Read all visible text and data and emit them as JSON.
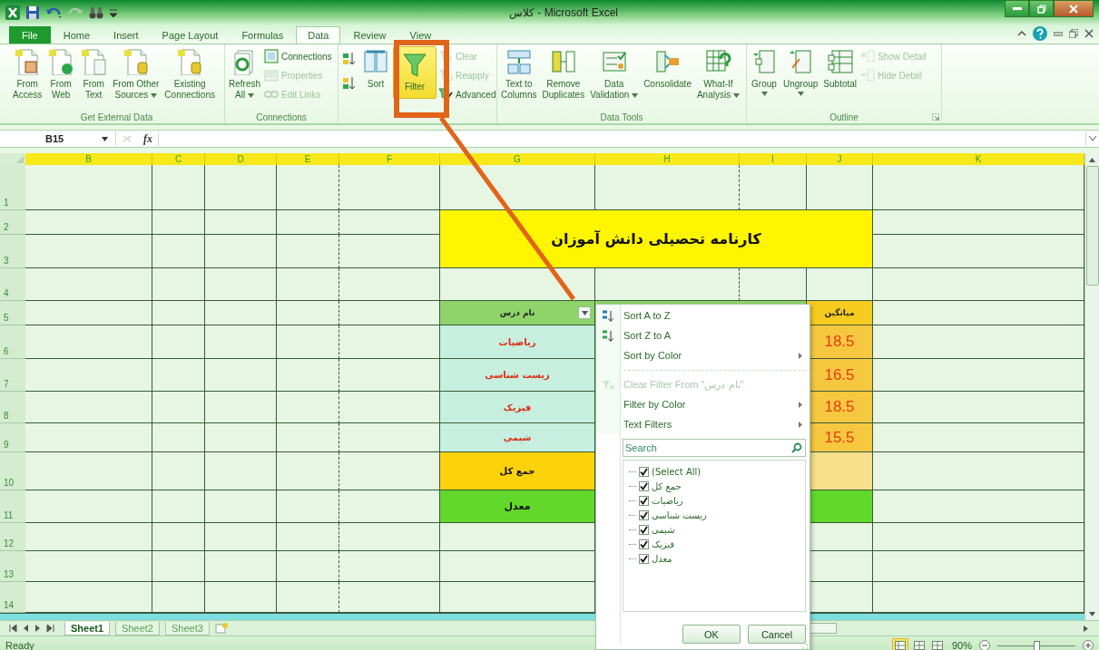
{
  "window": {
    "title": "کلاس - Microsoft Excel"
  },
  "ribbon_tabs": [
    {
      "label": "File",
      "kind": "file",
      "selected": false
    },
    {
      "label": "Home",
      "kind": "tab",
      "selected": false
    },
    {
      "label": "Insert",
      "kind": "tab",
      "selected": false
    },
    {
      "label": "Page Layout",
      "kind": "tab",
      "selected": false
    },
    {
      "label": "Formulas",
      "kind": "tab",
      "selected": false
    },
    {
      "label": "Data",
      "kind": "tab",
      "selected": true
    },
    {
      "label": "Review",
      "kind": "tab",
      "selected": false
    },
    {
      "label": "View",
      "kind": "tab",
      "selected": false
    }
  ],
  "ribbon_groups": [
    {
      "label": "Get External Data",
      "buttons": [
        {
          "label": "From\nAccess",
          "kind": "large",
          "dropdown": false,
          "disabled": false
        },
        {
          "label": "From\nWeb",
          "kind": "large",
          "dropdown": false,
          "disabled": false
        },
        {
          "label": "From\nText",
          "kind": "large",
          "dropdown": false,
          "disabled": false
        },
        {
          "label": "From Other\nSources",
          "kind": "large",
          "dropdown": true,
          "disabled": false
        },
        {
          "label": "Existing\nConnections",
          "kind": "large",
          "dropdown": false,
          "disabled": false
        }
      ]
    },
    {
      "label": "Connections",
      "buttons": [
        {
          "label": "Refresh\nAll",
          "kind": "large",
          "dropdown": true,
          "disabled": false
        },
        {
          "label": "Connections",
          "kind": "small",
          "dropdown": false,
          "disabled": false
        },
        {
          "label": "Properties",
          "kind": "small",
          "dropdown": false,
          "disabled": true
        },
        {
          "label": "Edit Links",
          "kind": "small",
          "dropdown": false,
          "disabled": true
        }
      ]
    },
    {
      "buttons": [
        {
          "kind": "icon",
          "disabled": false,
          "on": false
        },
        {
          "kind": "icon",
          "disabled": false,
          "on": false
        },
        {
          "label": "Sort",
          "kind": "large",
          "dropdown": false,
          "disabled": false,
          "on": false
        },
        {
          "label": "Filter",
          "kind": "large",
          "dropdown": false,
          "disabled": false,
          "on": true
        },
        {
          "label": "Clear",
          "kind": "small",
          "dropdown": false,
          "disabled": true,
          "on": false
        },
        {
          "label": "Reapply",
          "kind": "small",
          "dropdown": false,
          "disabled": true,
          "on": false
        },
        {
          "label": "Advanced",
          "kind": "small",
          "dropdown": false,
          "disabled": false,
          "on": false
        }
      ]
    },
    {
      "label": "Data Tools",
      "buttons": [
        {
          "label": "Text to\nColumns",
          "kind": "large",
          "dropdown": false,
          "disabled": false
        },
        {
          "label": "Remove\nDuplicates",
          "kind": "large",
          "dropdown": false,
          "disabled": false
        },
        {
          "label": "Data\nValidation",
          "kind": "large",
          "dropdown": true,
          "disabled": false
        },
        {
          "label": "Consolidate",
          "kind": "large",
          "dropdown": false,
          "disabled": false
        },
        {
          "label": "What-If\nAnalysis",
          "kind": "large",
          "dropdown": true,
          "disabled": false
        }
      ]
    },
    {
      "label": "Outline",
      "buttons": [
        {
          "label": "Group",
          "kind": "large",
          "dropdown": true,
          "disabled": false
        },
        {
          "label": "Ungroup",
          "kind": "large",
          "dropdown": true,
          "disabled": false
        },
        {
          "label": "Subtotal",
          "kind": "large",
          "dropdown": false,
          "disabled": false
        },
        {
          "label": "Show Detail",
          "kind": "small",
          "dropdown": false,
          "disabled": true
        },
        {
          "label": "Hide Detail",
          "kind": "small",
          "dropdown": false,
          "disabled": true
        }
      ]
    }
  ],
  "formula_bar": {
    "name_box": "B15",
    "function_label": "fx"
  },
  "sheet": {
    "columns": [
      "B",
      "C",
      "D",
      "E",
      "F",
      "G",
      "H",
      "I",
      "J",
      "K"
    ],
    "rows": [
      "1",
      "2",
      "3",
      "4",
      "5",
      "6",
      "7",
      "8",
      "9",
      "10",
      "11",
      "12",
      "13",
      "14"
    ]
  },
  "report": {
    "title": "کارنامه تحصیلی دانش آموزان",
    "subject_header": "نام درس",
    "average_header": "میانگین",
    "subjects": [
      {
        "name": "ریاضیات",
        "average": "18.5"
      },
      {
        "name": "زیست شناسی",
        "average": "16.5"
      },
      {
        "name": "فیزیک",
        "average": "18.5"
      },
      {
        "name": "شیمی",
        "average": "15.5"
      }
    ],
    "total_label": "جمع کل",
    "mean_label": "معدل"
  },
  "filter_menu": {
    "items": [
      {
        "label": "Sort A to Z",
        "kind": "sort-asc",
        "submenu": false,
        "disabled": false
      },
      {
        "label": "Sort Z to A",
        "kind": "sort-desc",
        "submenu": false,
        "disabled": false
      },
      {
        "label": "Sort by Color",
        "kind": "plain",
        "submenu": true,
        "disabled": false
      },
      {
        "kind": "separator"
      },
      {
        "label": "Clear Filter From \"نام درس\"",
        "kind": "clear",
        "submenu": false,
        "disabled": true
      },
      {
        "label": "Filter by Color",
        "kind": "plain",
        "submenu": true,
        "disabled": false
      },
      {
        "label": "Text Filters",
        "kind": "plain",
        "submenu": true,
        "disabled": false
      }
    ],
    "search": {
      "placeholder": "Search"
    },
    "options": [
      {
        "label": "(Select All)",
        "checked": true
      },
      {
        "label": "جمع کل",
        "checked": true
      },
      {
        "label": "ریاضیات",
        "checked": true
      },
      {
        "label": "زیست شناسی",
        "checked": true
      },
      {
        "label": "شیمی",
        "checked": true
      },
      {
        "label": "فیزیک",
        "checked": true
      },
      {
        "label": "معدل",
        "checked": true
      }
    ],
    "buttons": [
      "OK",
      "Cancel"
    ]
  },
  "sheet_tabs": [
    {
      "label": "Sheet1",
      "selected": true
    },
    {
      "label": "Sheet2",
      "selected": false
    },
    {
      "label": "Sheet3",
      "selected": false
    }
  ],
  "status_bar": {
    "text": "Ready",
    "views": [
      {
        "selected": true
      },
      {
        "selected": false
      },
      {
        "selected": false
      }
    ],
    "zoom": "90%",
    "level": 0.5
  }
}
